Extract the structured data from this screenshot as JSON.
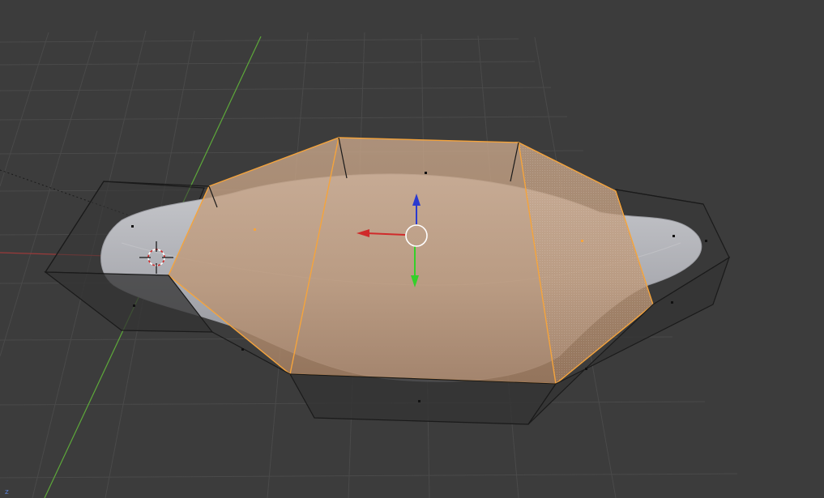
{
  "viewport": {
    "editor": "3D Viewport",
    "view": "user-perspective",
    "mode": "edit-mode-face-select",
    "axis_corner_label": "z"
  },
  "scene": {
    "grid": "visible",
    "x_axis_line_color": "#9a3a3a",
    "y_axis_line_color": "#5da83a",
    "mesh": "subdivided-elongated-body",
    "cage": "low-poly-control-cage",
    "selected_faces": "middle-section",
    "selection_color": "#f5a43c",
    "manipulator": "translate-gizmo",
    "gizmo_colors": {
      "x": "#d02a2a",
      "y": "#34d02a",
      "z": "#2a3ad0"
    },
    "cursor": "3d-cursor"
  }
}
